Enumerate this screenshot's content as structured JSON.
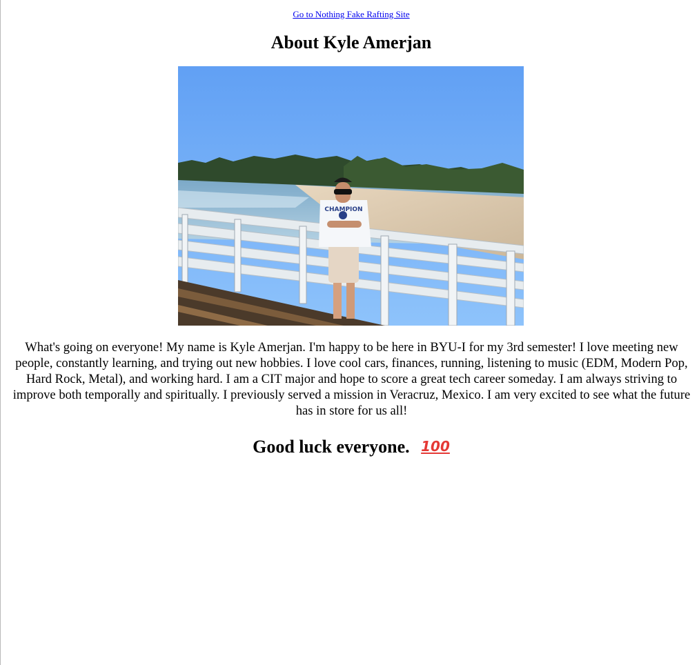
{
  "nav": {
    "link_text": "Go to Nothing Fake Rafting Site"
  },
  "page": {
    "title": "About Kyle Amerjan"
  },
  "photo": {
    "description_icon": "beach-pier-photo"
  },
  "bio": {
    "text": "What's going on everyone! My name is Kyle Amerjan. I'm happy to be here in BYU-I for my 3rd semester! I love meeting new people, constantly learning, and trying out new hobbies. I love cool cars, finances, running, listening to music (EDM, Modern Pop, Hard Rock, Metal), and working hard. I am a CIT major and hope to score a great tech career someday. I am always striving to improve both temporally and spiritually. I previously served a mission in Veracruz, Mexico. I am very excited to see what the future has in store for us all!"
  },
  "closing": {
    "text": "Good luck everyone.",
    "emoji": "100",
    "emoji_icon": "hundred-points-icon"
  },
  "colors": {
    "link": "#0000ee",
    "text": "#000000",
    "emoji": "#e53935"
  }
}
